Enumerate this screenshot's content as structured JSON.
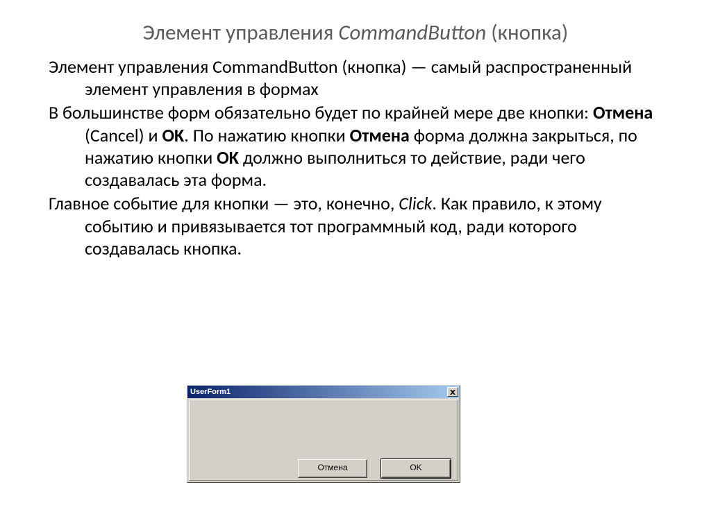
{
  "title": "Элемент управления CommandButton (кнопка)",
  "p1": {
    "a": "Элемент управления CommandButton (кнопка) — самый распространенный элемент управления в формах"
  },
  "p2": {
    "a": "В большинстве форм обязательно будет по крайней мере две кнопки: ",
    "b": "Отмена",
    "c": " (Cancel) и ",
    "d": "OK",
    "e": ". По нажатию кнопки ",
    "f": "Отмена",
    "g": " форма должна закрыться, по нажатию кнопки ",
    "h": "OK",
    "i": " должно выполниться то действие, ради чего создавалась эта форма."
  },
  "p3": {
    "a": "Главное событие для кнопки — это, конечно, ",
    "b": "Click",
    "c": ". Как правило, к этому событию и привязывается тот программный код, ради которого создавалась кнопка."
  },
  "userform": {
    "title": "UserForm1",
    "cancel": "Отмена",
    "ok": "OK"
  }
}
